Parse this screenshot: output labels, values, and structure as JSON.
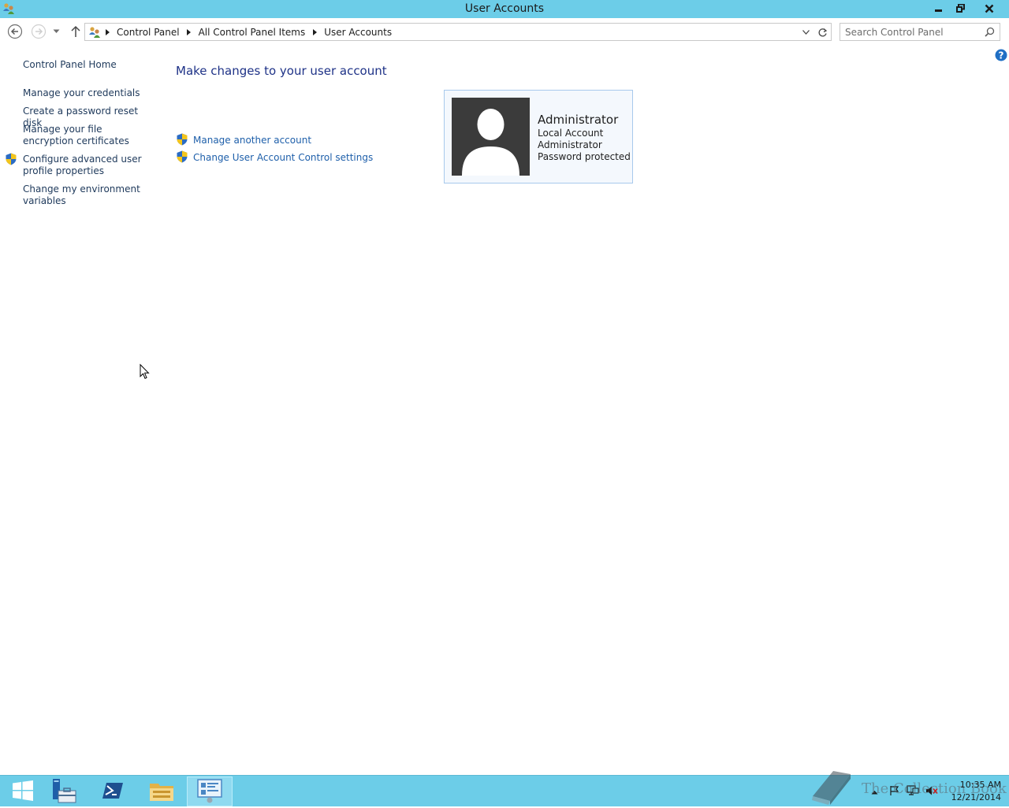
{
  "window": {
    "title": "User Accounts"
  },
  "address_bar": {
    "breadcrumbs": [
      "Control Panel",
      "All Control Panel Items",
      "User Accounts"
    ]
  },
  "search": {
    "placeholder": "Search Control Panel"
  },
  "sidebar": {
    "home": "Control Panel Home",
    "items": [
      {
        "label": "Manage your credentials",
        "shield": false
      },
      {
        "label": "Create a password reset disk",
        "shield": false
      },
      {
        "label": "Manage your file encryption certificates",
        "shield": false
      },
      {
        "label": "Configure advanced user profile properties",
        "shield": true
      },
      {
        "label": "Change my environment variables",
        "shield": false
      }
    ]
  },
  "main": {
    "title": "Make changes to your user account",
    "tasks": [
      {
        "label": "Manage another account",
        "icon": "uac-shield-icon"
      },
      {
        "label": "Change User Account Control settings",
        "icon": "uac-shield-icon"
      }
    ],
    "account": {
      "name": "Administrator",
      "type": "Local Account",
      "role": "Administrator",
      "status": "Password protected"
    }
  },
  "taskbar": {
    "items": [
      "start-icon",
      "server-manager-icon",
      "powershell-icon",
      "file-explorer-icon",
      "user-accounts-icon"
    ],
    "active_item": "user-accounts-icon",
    "watermark": "The Collection Book",
    "clock": {
      "time": "10:35 AM",
      "date": "12/21/2014"
    }
  },
  "colors": {
    "titlebar": "#6ccde8",
    "link": "#1e395b",
    "task_link": "#1e5faa",
    "heading": "#1e3287"
  }
}
